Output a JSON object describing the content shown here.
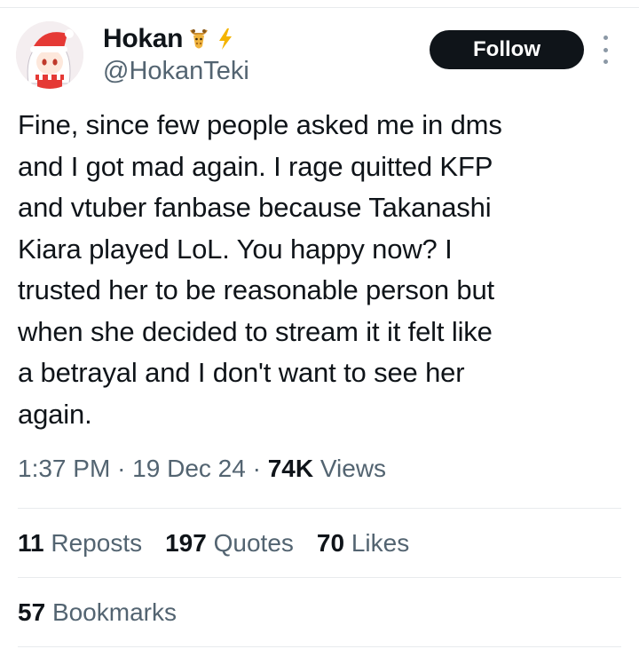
{
  "tweet": {
    "author": {
      "display_name": "Hokan",
      "handle": "@HokanTeki",
      "emoji_1": "giraffe-emoji",
      "emoji_2": "lightning-emoji"
    },
    "follow_label": "Follow",
    "text": "Fine, since few people asked me in dms\nand I got mad again. I rage quitted KFP\nand vtuber fanbase because Takanashi\nKiara played LoL. You happy now? I\ntrusted her to be reasonable person but\nwhen she decided to stream it it felt like\na betrayal and I don't want to see her\nagain.",
    "time": "1:37 PM",
    "sep_1": "·",
    "date": "19 Dec 24",
    "sep_2": "·",
    "views_count": "74K",
    "views_label": "Views",
    "reposts_count": "11",
    "reposts_label": "Reposts",
    "quotes_count": "197",
    "quotes_label": "Quotes",
    "likes_count": "70",
    "likes_label": "Likes",
    "bookmarks_count": "57",
    "bookmarks_label": "Bookmarks"
  },
  "colors": {
    "text_primary": "#0f1419",
    "text_secondary": "#536471",
    "button_bg": "#0f1419",
    "divider": "#e8ebed"
  }
}
